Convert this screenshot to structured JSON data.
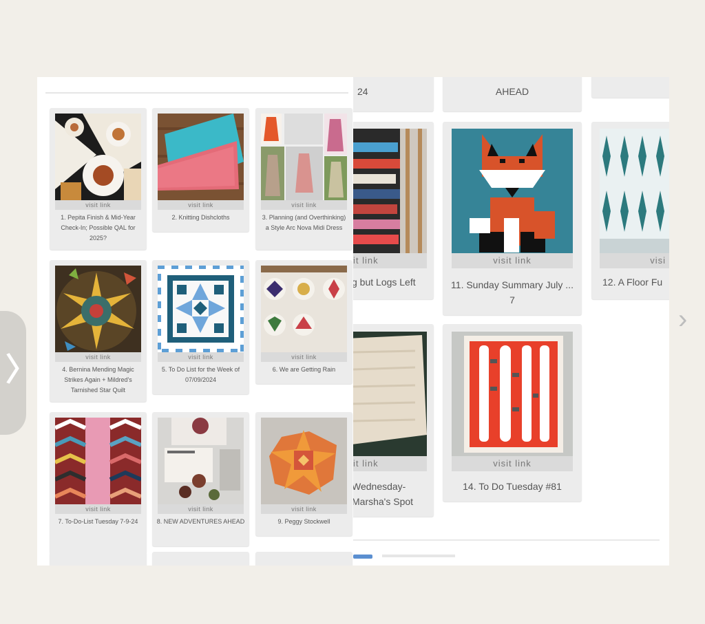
{
  "nav": {
    "prev_icon": "‹",
    "next_icon": "›",
    "side_tab_icon": "〉"
  },
  "left_cards": [
    {
      "visit": "visit link",
      "caption": "1. Pepita Finish & Mid-Year Check-In; Possible QAL for 2025?"
    },
    {
      "visit": "visit link",
      "caption": "2. Knitting Dishcloths"
    },
    {
      "visit": "visit link",
      "caption": "3. Planning (and Overthinking) a Style Arc Nova Midi Dress"
    },
    {
      "visit": "visit link",
      "caption": "4. Bernina Mending Magic Strikes Again + Mildred's Tarnished Star Quilt"
    },
    {
      "visit": "visit link",
      "caption": "5. To Do List for the Week of 07/09/2024"
    },
    {
      "visit": "visit link",
      "caption": "6. We are Getting Rain"
    },
    {
      "visit": "visit link",
      "caption": "7. To-Do-List Tuesday 7-9-24"
    },
    {
      "visit": "visit link",
      "caption": "8. NEW ADVENTURES AHEAD"
    },
    {
      "visit": "visit link",
      "caption": "9. Peggy Stockwell"
    }
  ],
  "right_top": {
    "a": "24",
    "b": "AHEAD"
  },
  "right_cards": [
    {
      "visit": "it link",
      "caption": "g but Logs Left"
    },
    {
      "visit": "visit link",
      "caption": "11. Sunday Summary July ... 7"
    },
    {
      "visit": "visi",
      "caption": "12. A Floor Fu"
    },
    {
      "visit": "it link",
      "caption": "Wednesday- Marsha's Spot"
    },
    {
      "visit": "visit link",
      "caption": "14. To Do Tuesday #81"
    }
  ],
  "colors": {
    "background": "#f2efe9",
    "card": "#ececec",
    "link_bar": "#dadada",
    "text": "#555555"
  }
}
